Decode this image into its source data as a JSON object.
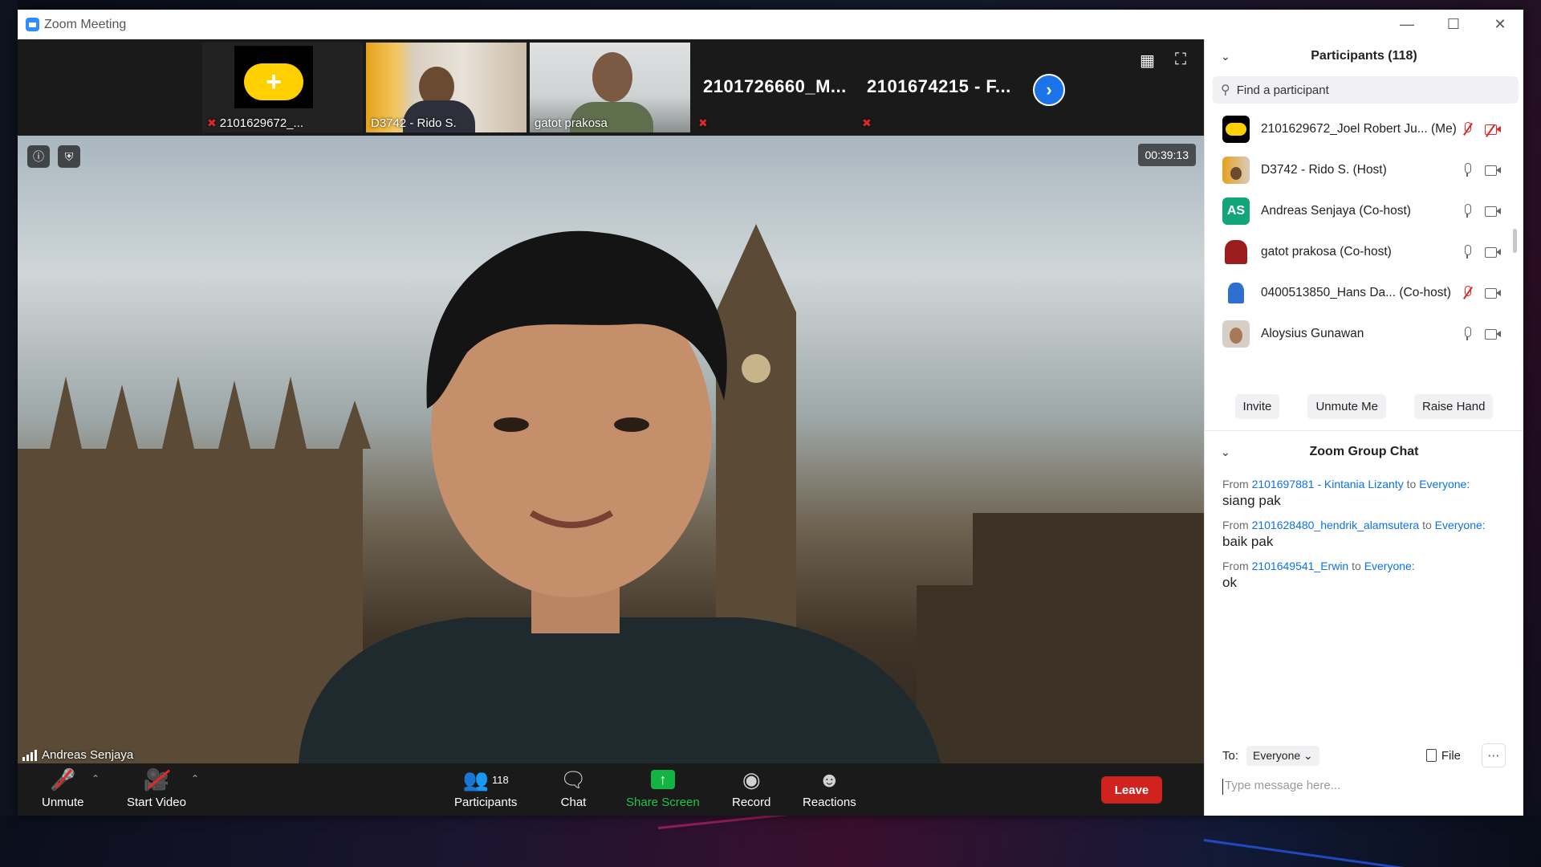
{
  "window": {
    "title": "Zoom Meeting"
  },
  "thumbnails": [
    {
      "name": "2101629672_...",
      "muted": true,
      "type": "avatar"
    },
    {
      "name": "D3742 - Rido S.",
      "muted": false,
      "type": "video"
    },
    {
      "name": "gatot prakosa",
      "muted": false,
      "type": "video"
    },
    {
      "name": "2101726660_M...",
      "muted": true,
      "type": "text"
    },
    {
      "name": "2101674215 - F...",
      "muted": true,
      "type": "text"
    }
  ],
  "main_video": {
    "speaker": "Andreas Senjaya",
    "timer": "00:39:13"
  },
  "toolbar": {
    "unmute": "Unmute",
    "start_video": "Start Video",
    "participants": "Participants",
    "participants_count": "118",
    "chat": "Chat",
    "share_screen": "Share Screen",
    "record": "Record",
    "reactions": "Reactions",
    "leave": "Leave"
  },
  "participants_panel": {
    "title": "Participants (118)",
    "search_placeholder": "Find a participant",
    "list": [
      {
        "name": "2101629672_Joel Robert Ju... (Me)",
        "mic": "off",
        "cam": "off",
        "avatar": "yellow-pill"
      },
      {
        "name": "D3742 - Rido S. (Host)",
        "mic": "on",
        "cam": "on",
        "avatar": "photo"
      },
      {
        "name": "Andreas Senjaya (Co-host)",
        "mic": "on",
        "cam": "on",
        "avatar": "AS",
        "avatar_color": "#12a57a"
      },
      {
        "name": "gatot prakosa (Co-host)",
        "mic": "on",
        "cam": "on",
        "avatar": "photo-red"
      },
      {
        "name": "0400513850_Hans Da...  (Co-host)",
        "mic": "off",
        "cam": "on",
        "avatar": "cartoon"
      },
      {
        "name": "Aloysius Gunawan",
        "mic": "on",
        "cam": "on",
        "avatar": "photo"
      }
    ],
    "buttons": {
      "invite": "Invite",
      "unmute_me": "Unmute Me",
      "raise_hand": "Raise Hand"
    }
  },
  "chat": {
    "title": "Zoom Group Chat",
    "messages": [
      {
        "from_label": "From",
        "sender": "2101697881 - Kintania Lizanty",
        "to_label": "to",
        "recipient": "Everyone:",
        "text": "siang pak"
      },
      {
        "from_label": "From",
        "sender": "2101628480_hendrik_alamsutera",
        "to_label": "to",
        "recipient": "Everyone:",
        "text": "baik pak"
      },
      {
        "from_label": "From",
        "sender": "2101649541_Erwin",
        "to_label": "to",
        "recipient": "Everyone:",
        "text": "ok"
      }
    ],
    "to_label": "To:",
    "to_value": "Everyone",
    "file_label": "File",
    "input_placeholder": "Type message here..."
  }
}
